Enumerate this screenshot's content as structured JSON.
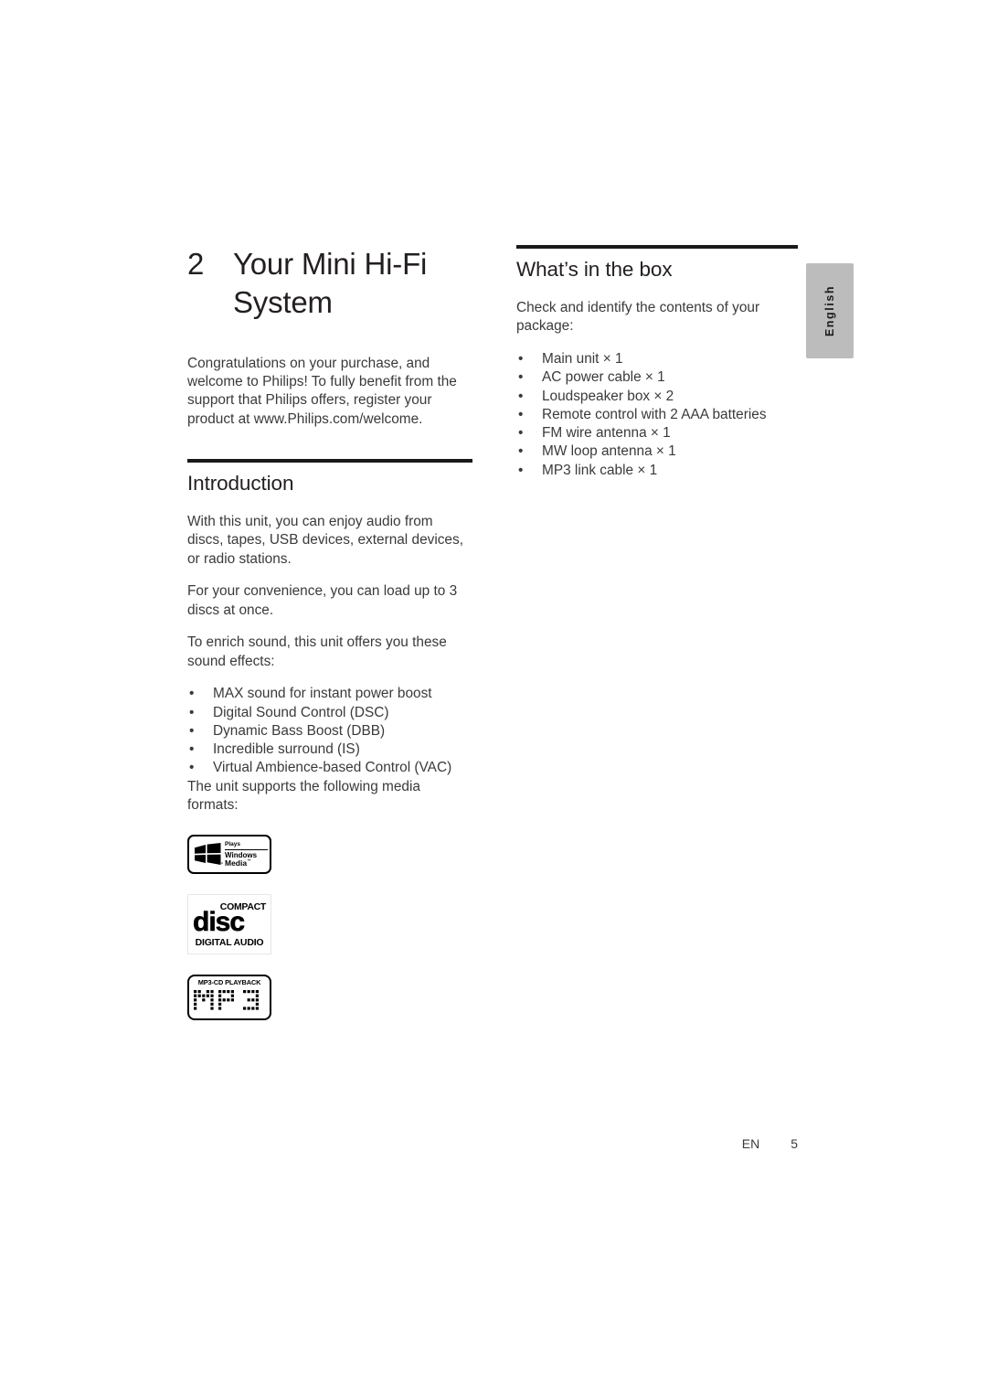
{
  "side_tab": {
    "language": "English"
  },
  "left_column": {
    "chapter": {
      "number": "2",
      "title": "Your Mini Hi-Fi System"
    },
    "lede": "Congratulations on your purchase, and welcome to Philips! To fully benefit from the support that Philips offers, register your product at www.Philips.com/welcome.",
    "introduction": {
      "heading": "Introduction",
      "paragraph_1": "With this unit, you can enjoy audio from discs, tapes, USB devices, external devices, or radio stations.",
      "paragraph_2": "For your convenience, you can load up to 3 discs at once.",
      "paragraph_3": "To enrich sound, this unit offers you these sound effects:",
      "sound_effects": [
        "MAX sound for instant power boost",
        "Digital Sound Control (DSC)",
        "Dynamic Bass Boost (DBB)",
        "Incredible surround (IS)",
        "Virtual Ambience-based Control (VAC)"
      ],
      "paragraph_4": "The unit supports the following media formats:",
      "bullet_glyph": "•"
    },
    "logos": [
      {
        "id": "plays-windows-media-logo",
        "line_1": "Plays",
        "line_2": "Windows",
        "line_3": "Media",
        "trademark": "™",
        "flag_trademark": "™"
      },
      {
        "id": "compact-disc-digital-audio-logo",
        "line_1": "COMPACT",
        "line_2": "disc",
        "line_3": "DIGITAL AUDIO"
      },
      {
        "id": "mp3-cd-playback-logo",
        "caption": "MP3-CD PLAYBACK",
        "wordmark": "MP3"
      }
    ]
  },
  "right_column": {
    "whats_in_the_box": {
      "heading": "What’s in the box",
      "paragraph": "Check and identify the contents of your package:",
      "items": [
        "Main unit × 1",
        "AC power cable × 1",
        "Loudspeaker box × 2",
        "Remote control with 2 AAA batteries",
        "FM wire antenna × 1",
        "MW loop antenna × 1",
        "MP3 link cable × 1"
      ],
      "bullet_glyph": "•"
    }
  },
  "footer": {
    "language_code": "EN",
    "page_number": "5"
  },
  "colors": {
    "text": "#231f20",
    "body_text": "#3a3a3a",
    "rule": "#1a1a1a",
    "tab_background": "#bcbcbc"
  }
}
